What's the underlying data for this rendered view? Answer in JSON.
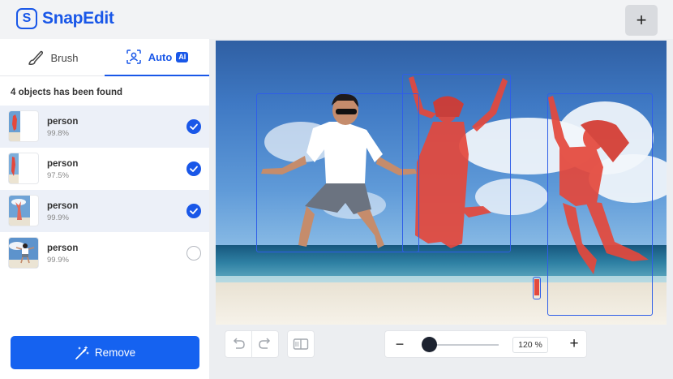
{
  "app": {
    "name": "SnapEdit"
  },
  "header": {
    "add_label": "+"
  },
  "tabs": [
    {
      "label": "Brush",
      "icon": "brush-icon",
      "active": false
    },
    {
      "label": "Auto",
      "icon": "auto-detect-icon",
      "badge": "AI",
      "active": true
    }
  ],
  "detection": {
    "found_text": "4 objects has been found",
    "objects": [
      {
        "label": "person",
        "score": "99.8%",
        "selected": true
      },
      {
        "label": "person",
        "score": "97.5%",
        "selected": true
      },
      {
        "label": "person",
        "score": "99.9%",
        "selected": true
      },
      {
        "label": "person",
        "score": "99.9%",
        "selected": false
      }
    ]
  },
  "actions": {
    "remove_label": "Remove",
    "remove_icon": "magic-wand-icon"
  },
  "toolbar": {
    "undo_icon": "undo-icon",
    "redo_icon": "redo-icon",
    "compare_icon": "compare-icon",
    "zoom_minus": "−",
    "zoom_plus": "+",
    "zoom_level": "120 %",
    "zoom_slider_fraction": 0.05
  },
  "colors": {
    "accent": "#1957e8",
    "mask": "#e4483c",
    "selected_row": "#ecf0f8"
  }
}
